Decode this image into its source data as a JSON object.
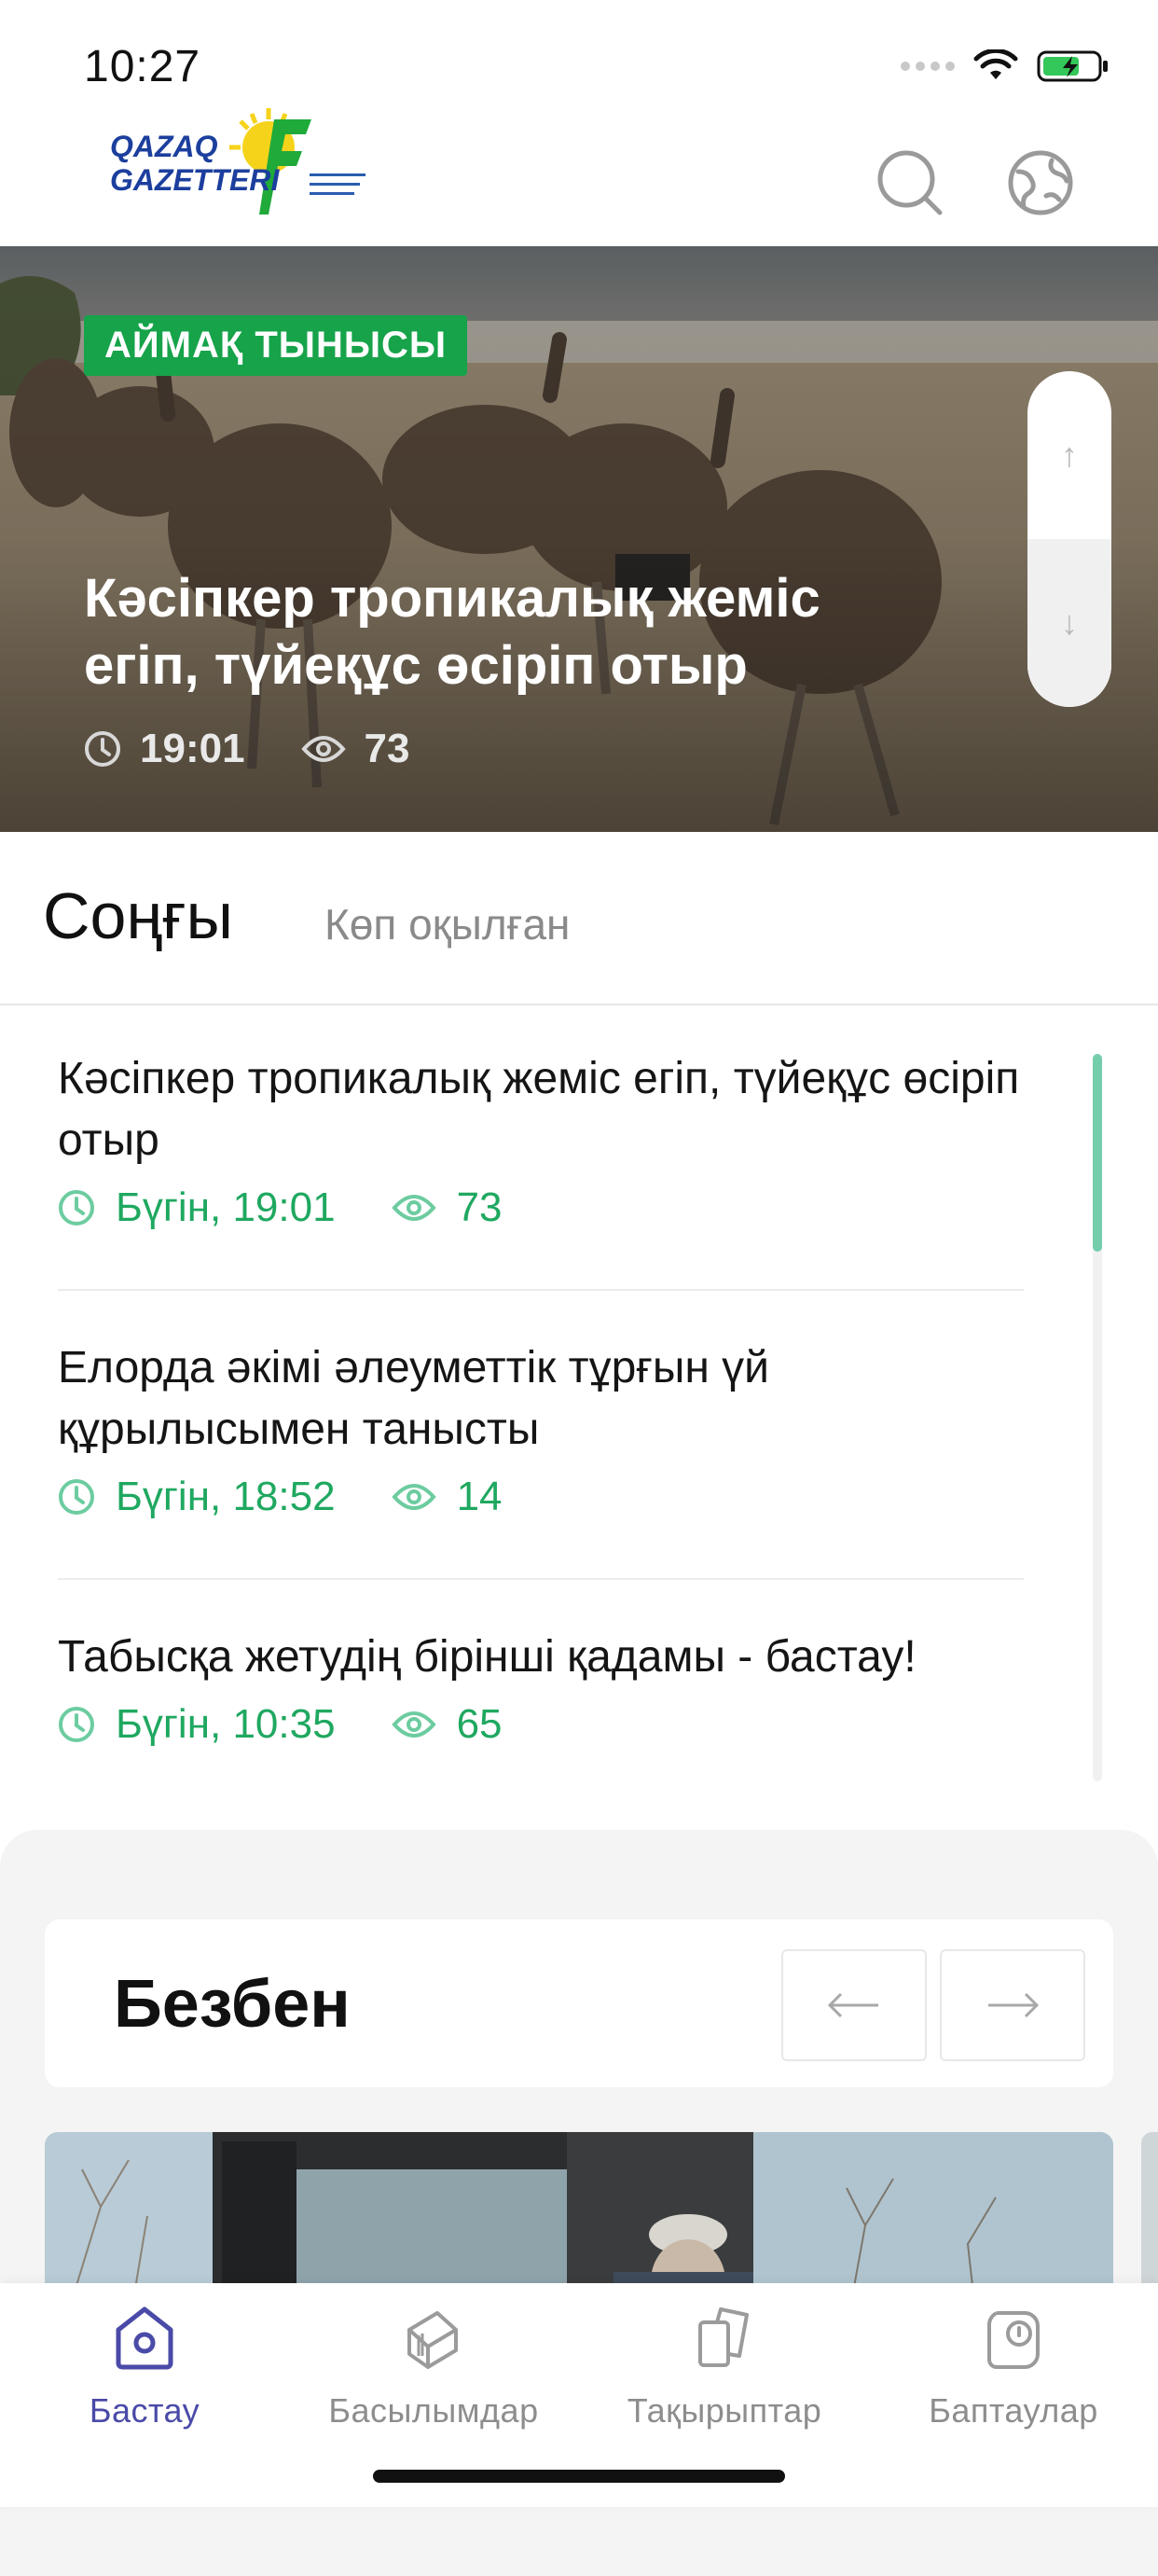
{
  "status": {
    "time": "10:27"
  },
  "logo": {
    "line1": "QAZAQ",
    "line2": "GAZETTERI"
  },
  "hero": {
    "tag": "АЙМАҚ ТЫНЫСЫ",
    "title": "Кәсіпкер тропикалық жеміс егіп, түйеқұс өсіріп отыр",
    "time": "19:01",
    "views": "73"
  },
  "tabs": {
    "active": "Соңғы",
    "inactive": "Көп оқылған"
  },
  "news": [
    {
      "title": "Кәсіпкер тропикалық жеміс егіп, түйеқұс өсіріп отыр",
      "time": "Бүгін, 19:01",
      "views": "73"
    },
    {
      "title": "Елорда әкімі әлеуметтік тұрғын үй құрылысымен танысты",
      "time": "Бүгін, 18:52",
      "views": "14"
    },
    {
      "title": "Табысқа жетудің бірінші қадамы - бастау!",
      "time": "Бүгін, 10:35",
      "views": "65"
    }
  ],
  "section": {
    "title": "Безбен"
  },
  "bottom_nav": [
    {
      "label": "Бастау",
      "icon": "home-icon"
    },
    {
      "label": "Басылымдар",
      "icon": "publications-icon"
    },
    {
      "label": "Тақырыптар",
      "icon": "topics-icon"
    },
    {
      "label": "Баптаулар",
      "icon": "settings-icon"
    }
  ],
  "colors": {
    "accent_green": "#1fa860",
    "tag_green": "#16a34a",
    "active_nav": "#4a4aa8"
  }
}
